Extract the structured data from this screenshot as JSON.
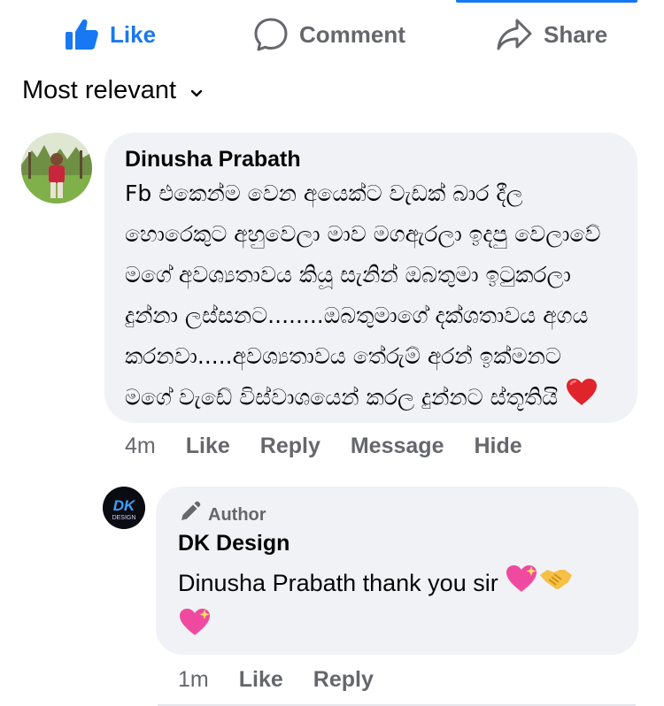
{
  "actions": {
    "like": "Like",
    "comment": "Comment",
    "share": "Share"
  },
  "sort": {
    "label": "Most relevant"
  },
  "comment": {
    "author": "Dinusha Prabath",
    "lines": [
      "Fb එකෙන්ම වෙන අයෙක්ට  වැඩක් බාර දීල",
      "හොරෙකුට අහුවෙලා මාව මගඇරලා ඉදපු වෙලාවේ",
      "මගේ අවශ්‍යතාවය කියූ සැනින් ඔබතුමා ඉටුකරලා",
      "දුන්නා ලස්සනට........ඔබතුමාගේ දක්ශතාවය අගය",
      "කරනවා.....අවශ්‍යතාවය තේරුම් අරන් ඉක්මනට",
      "මගේ වැඩේ විස්වාශයෙන් කරල දුන්නට ස්තූතියි"
    ],
    "time": "4m",
    "like": "Like",
    "reply": "Reply",
    "message": "Message",
    "hide": "Hide"
  },
  "reply": {
    "badge": "Author",
    "author": "DK Design",
    "text": "Dinusha Prabath thank you sir",
    "time": "1m",
    "like": "Like",
    "reply": "Reply"
  },
  "avatar_dk_logo": {
    "top": "DK",
    "bottom": "DESIGN"
  },
  "colors": {
    "accent": "#1877f2",
    "muted": "#65676b",
    "bubble": "#f0f2f5"
  }
}
